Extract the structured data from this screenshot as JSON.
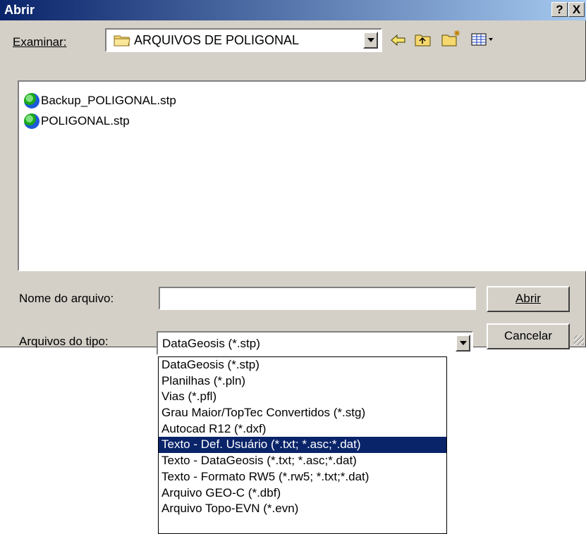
{
  "window": {
    "title": "Abrir",
    "help": "?",
    "close": "X"
  },
  "look_in": {
    "label": "Examinar:",
    "value": "ARQUIVOS DE POLIGONAL"
  },
  "toolbar": {
    "back": "back-arrow-icon",
    "up": "up-folder-icon",
    "new_folder": "new-folder-icon",
    "view": "view-menu-icon"
  },
  "files": [
    {
      "name": "Backup_POLIGONAL.stp",
      "icon": "datageosis-file-icon"
    },
    {
      "name": "POLIGONAL.stp",
      "icon": "datageosis-file-icon"
    }
  ],
  "filename": {
    "label": "Nome do arquivo:",
    "value": ""
  },
  "filetype": {
    "label": "Arquivos do tipo:",
    "value": "DataGeosis (*.stp)"
  },
  "buttons": {
    "open": "Abrir",
    "cancel": "Cancelar"
  },
  "filetype_options": [
    {
      "label": "DataGeosis (*.stp)",
      "selected": false
    },
    {
      "label": "Planilhas (*.pln)",
      "selected": false
    },
    {
      "label": "Vias (*.pfl)",
      "selected": false
    },
    {
      "label": "Grau Maior/TopTec Convertidos (*.stg)",
      "selected": false
    },
    {
      "label": "Autocad R12 (*.dxf)",
      "selected": false
    },
    {
      "label": "Texto - Def. Usuário (*.txt; *.asc;*.dat)",
      "selected": true
    },
    {
      "label": "Texto - DataGeosis (*.txt; *.asc;*.dat)",
      "selected": false
    },
    {
      "label": "Texto - Formato RW5 (*.rw5; *.txt;*.dat)",
      "selected": false
    },
    {
      "label": "Arquivo GEO-C (*.dbf)",
      "selected": false
    },
    {
      "label": "Arquivo Topo-EVN (*.evn)",
      "selected": false
    }
  ],
  "colors": {
    "selection": "#0a246a",
    "face": "#d4d0c8",
    "title_start": "#0a246a",
    "title_end": "#a6caf0"
  }
}
